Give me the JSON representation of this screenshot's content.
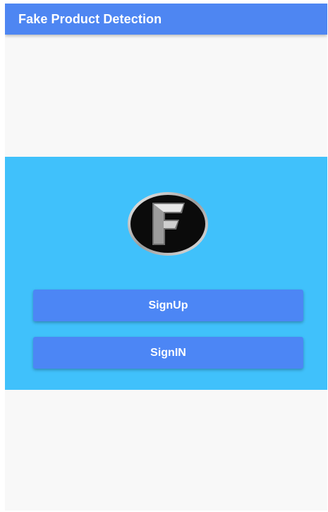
{
  "appbar": {
    "title": "Fake Product Detection"
  },
  "logo": {
    "icon": "letter-f-logo-icon",
    "letter": "F"
  },
  "buttons": {
    "signup_label": "SignUp",
    "signin_label": "SignIN"
  },
  "colors": {
    "appbar": "#4e86f2",
    "panel": "#40c1fb",
    "button": "#4c86f5",
    "background": "#f8f8f8"
  }
}
